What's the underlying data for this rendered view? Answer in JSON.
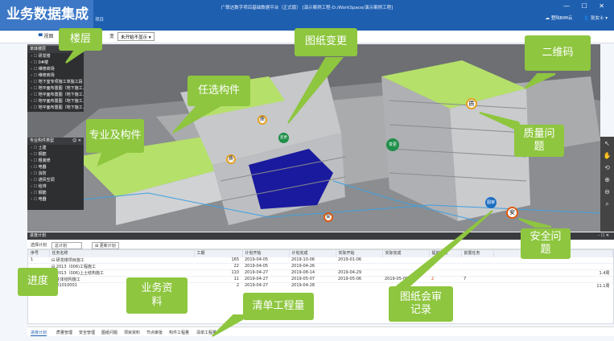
{
  "slide_title": "业务数据集成",
  "app": {
    "title": "广联达数字项目基础数据平台（正式版） [演示案例工程-D:/WorkSpace/演示案例工程]",
    "subtitle": "项目",
    "window_controls": "— ☐ ✕",
    "bim_label": "☁ 登陆BIM云",
    "user_label": "👤 张女士 ▾"
  },
  "toolbar": {
    "view_label": "视图",
    "filter_label": "变",
    "select_value": "未开始不显示 ▾"
  },
  "floor_panel": {
    "title": "单体楼层",
    "items": [
      "研发楼",
      "0#楼",
      "维修商场",
      "维修商场",
      "地下室专项施工单独工段",
      "地平面布置图（地下施工…",
      "地平面布置图（地下施工…",
      "地平面布置图（地下施工…",
      "地平面布置图（地下施工…"
    ]
  },
  "discipline_panel": {
    "title": "专业构件类型",
    "controls": "☺ ✕",
    "items": [
      "土建",
      "钢筋",
      "粗装修",
      "电器",
      "消防",
      "通风空调",
      "给排",
      "钢筋",
      "电器"
    ]
  },
  "markers": {
    "quality": "质",
    "change": "变更",
    "review": "图审",
    "safety": "安"
  },
  "grid": {
    "header": "进度计划",
    "controls": "- ☐ ✕",
    "select_label": "选择计划",
    "select_value": "总计划",
    "view_button": "⊞ 更新计划",
    "columns": [
      "序号",
      "任务名称",
      "工期",
      "计划开始",
      "计划完成",
      "实际开始",
      "实际完成",
      "提前天数",
      "前置任务"
    ],
    "rows": [
      [
        "1",
        "⊟ 研发楼项目施工",
        "165",
        "2019-04-05",
        "2019-10-06",
        "2019-01-06",
        "",
        "",
        ""
      ],
      [
        "",
        "⊟ 2013（006)工程施工",
        "22",
        "2019-04-05",
        "2019-04-26",
        "",
        "",
        "",
        ""
      ],
      [
        "",
        "⊟ 2013（006)上土结构施工",
        "110",
        "2019-04-27",
        "2019-08-14",
        "2019-04-29",
        "",
        "",
        ""
      ],
      [
        "",
        "⊟ 主体结构施工",
        "11",
        "2019-04-27",
        "2019-05-07",
        "2019-05-06",
        "2019-05-09",
        "2",
        "7"
      ],
      [
        "",
        "    0101010001",
        "2",
        "2019-04-27",
        "2019-04-28",
        "",
        "",
        "",
        ""
      ]
    ],
    "row_notes": [
      "",
      "",
      "1.4周",
      "",
      "11.1周"
    ]
  },
  "tabs": [
    "进度计划",
    "质量管理",
    "安全管理",
    "图纸问题",
    "项目资料",
    "节点审批",
    "构件工程量",
    "清单工程量"
  ],
  "callouts": {
    "floor": "楼层",
    "drawing_change": "图纸变更",
    "qr_code": "二维码",
    "selected_component": "任选构件",
    "discipline_component": "专业及构件",
    "quality_issue": "质量问题",
    "safety_issue": "安全问题",
    "progress": "进度",
    "business_docs": "业务资料",
    "quantity_list": "清单工程量",
    "drawing_review": "图纸会审记录"
  },
  "colors": {
    "accent": "#1f5fb0",
    "callout": "#8ec63f",
    "highlight_green": "#b5e06a",
    "selection_blue": "#1a1a9e"
  }
}
